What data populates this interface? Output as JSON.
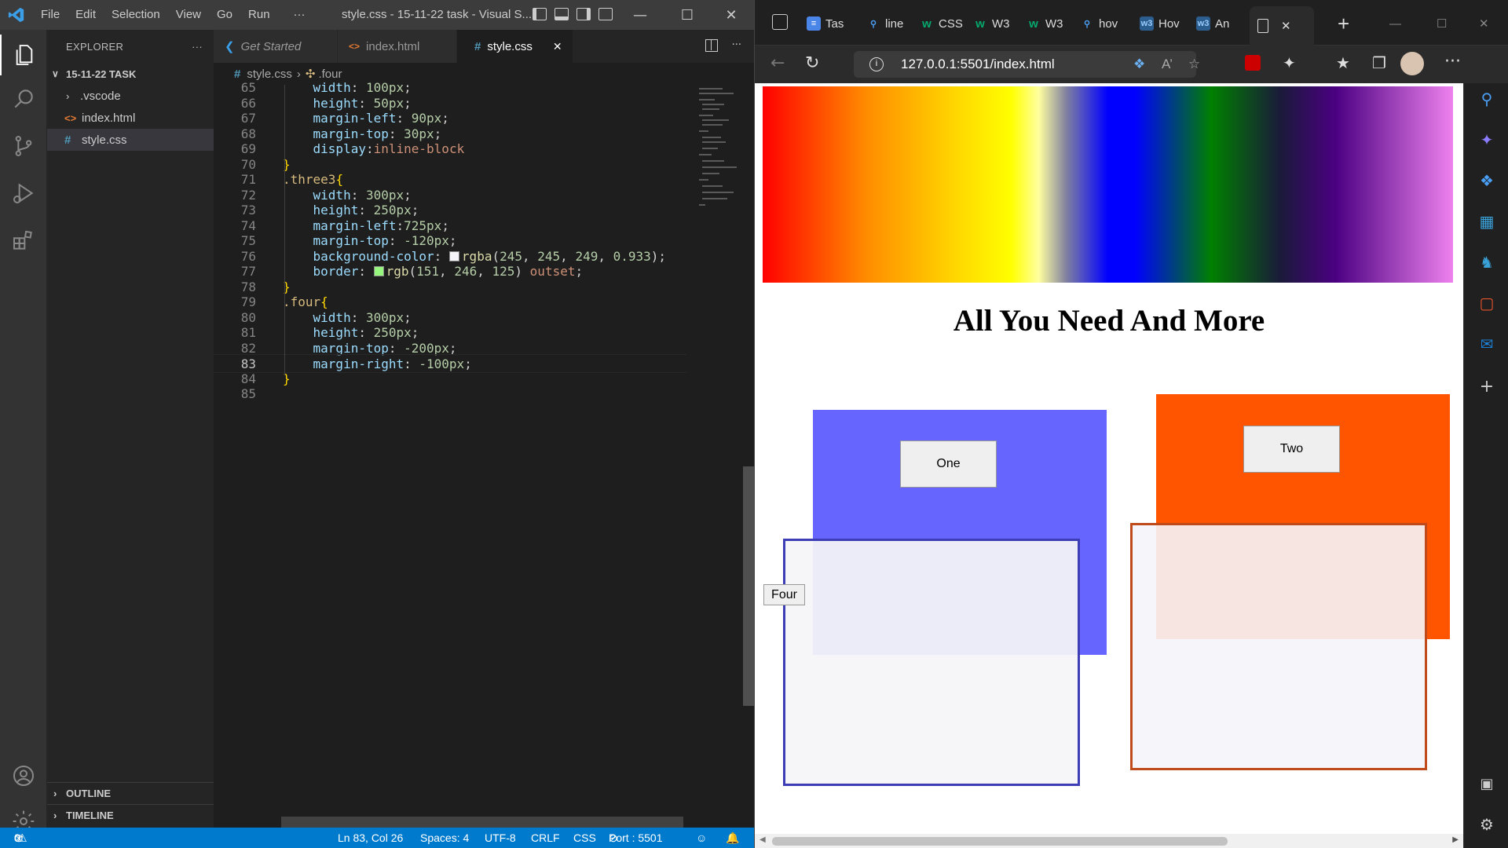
{
  "vscode": {
    "menu": [
      "File",
      "Edit",
      "Selection",
      "View",
      "Go",
      "Run",
      "···"
    ],
    "window_title": "style.css - 15-11-22 task - Visual S...",
    "explorer": {
      "title": "EXPLORER",
      "more": "···",
      "folder": "15-11-22 TASK",
      "items": [
        {
          "label": ".vscode",
          "icon": "chevron-right-icon"
        },
        {
          "label": "index.html",
          "icon": "html-file-icon"
        },
        {
          "label": "style.css",
          "icon": "css-file-icon"
        }
      ],
      "outline": "OUTLINE",
      "timeline": "TIMELINE"
    },
    "tabs": [
      {
        "label": "Get Started",
        "icon": "vscode-icon"
      },
      {
        "label": "index.html",
        "icon": "html-file-icon"
      },
      {
        "label": "style.css",
        "icon": "css-file-icon",
        "close": "✕"
      }
    ],
    "breadcrumb": {
      "file": "style.css",
      "symbol": ".four"
    },
    "code": [
      {
        "n": "65",
        "t": "    width: 100px;"
      },
      {
        "n": "66",
        "t": "    height: 50px;"
      },
      {
        "n": "67",
        "t": "    margin-left: 90px;"
      },
      {
        "n": "68",
        "t": "    margin-top: 30px;"
      },
      {
        "n": "69",
        "t": "    display:inline-block"
      },
      {
        "n": "70",
        "t": "}"
      },
      {
        "n": "71",
        "t": ".three3{"
      },
      {
        "n": "72",
        "t": "    width: 300px;"
      },
      {
        "n": "73",
        "t": "    height: 250px;"
      },
      {
        "n": "74",
        "t": "    margin-left:725px;"
      },
      {
        "n": "75",
        "t": "    margin-top: -120px;"
      },
      {
        "n": "76",
        "t": "    background-color: rgba(245, 245, 249, 0.933);"
      },
      {
        "n": "77",
        "t": "    border: rgb(151, 246, 125) outset;"
      },
      {
        "n": "78",
        "t": "}"
      },
      {
        "n": "79",
        "t": ".four{"
      },
      {
        "n": "80",
        "t": "    width: 300px;"
      },
      {
        "n": "81",
        "t": "    height: 250px;"
      },
      {
        "n": "82",
        "t": "    margin-top: -200px;"
      },
      {
        "n": "83",
        "t": "    margin-right: -100px;"
      },
      {
        "n": "84",
        "t": "}"
      },
      {
        "n": "85",
        "t": ""
      }
    ],
    "current_line": "83",
    "status": {
      "errors": "0",
      "warnings": "0",
      "position": "Ln 83, Col 26",
      "spaces": "Spaces: 4",
      "encoding": "UTF-8",
      "eol": "CRLF",
      "language": "CSS",
      "port": "Port : 5501"
    },
    "colors": {
      "accent": "#007acc",
      "swatch_bg": "#f5f5f9",
      "swatch_border": "#97f67d"
    }
  },
  "browser": {
    "tabs": [
      "Tas",
      "line",
      "CSS",
      "W3",
      "W3",
      "hov",
      "Hov",
      "An"
    ],
    "url": "127.0.0.1:5501/index.html",
    "page": {
      "heading": "All You Need And More",
      "buttons": {
        "one": "One",
        "two": "Two",
        "four": "Four"
      },
      "colors": {
        "box_one": "#6666ff",
        "box_two": "#ff5500",
        "box_three_border": "#3d3db5",
        "box_four_border": "#c04a1a"
      }
    }
  }
}
